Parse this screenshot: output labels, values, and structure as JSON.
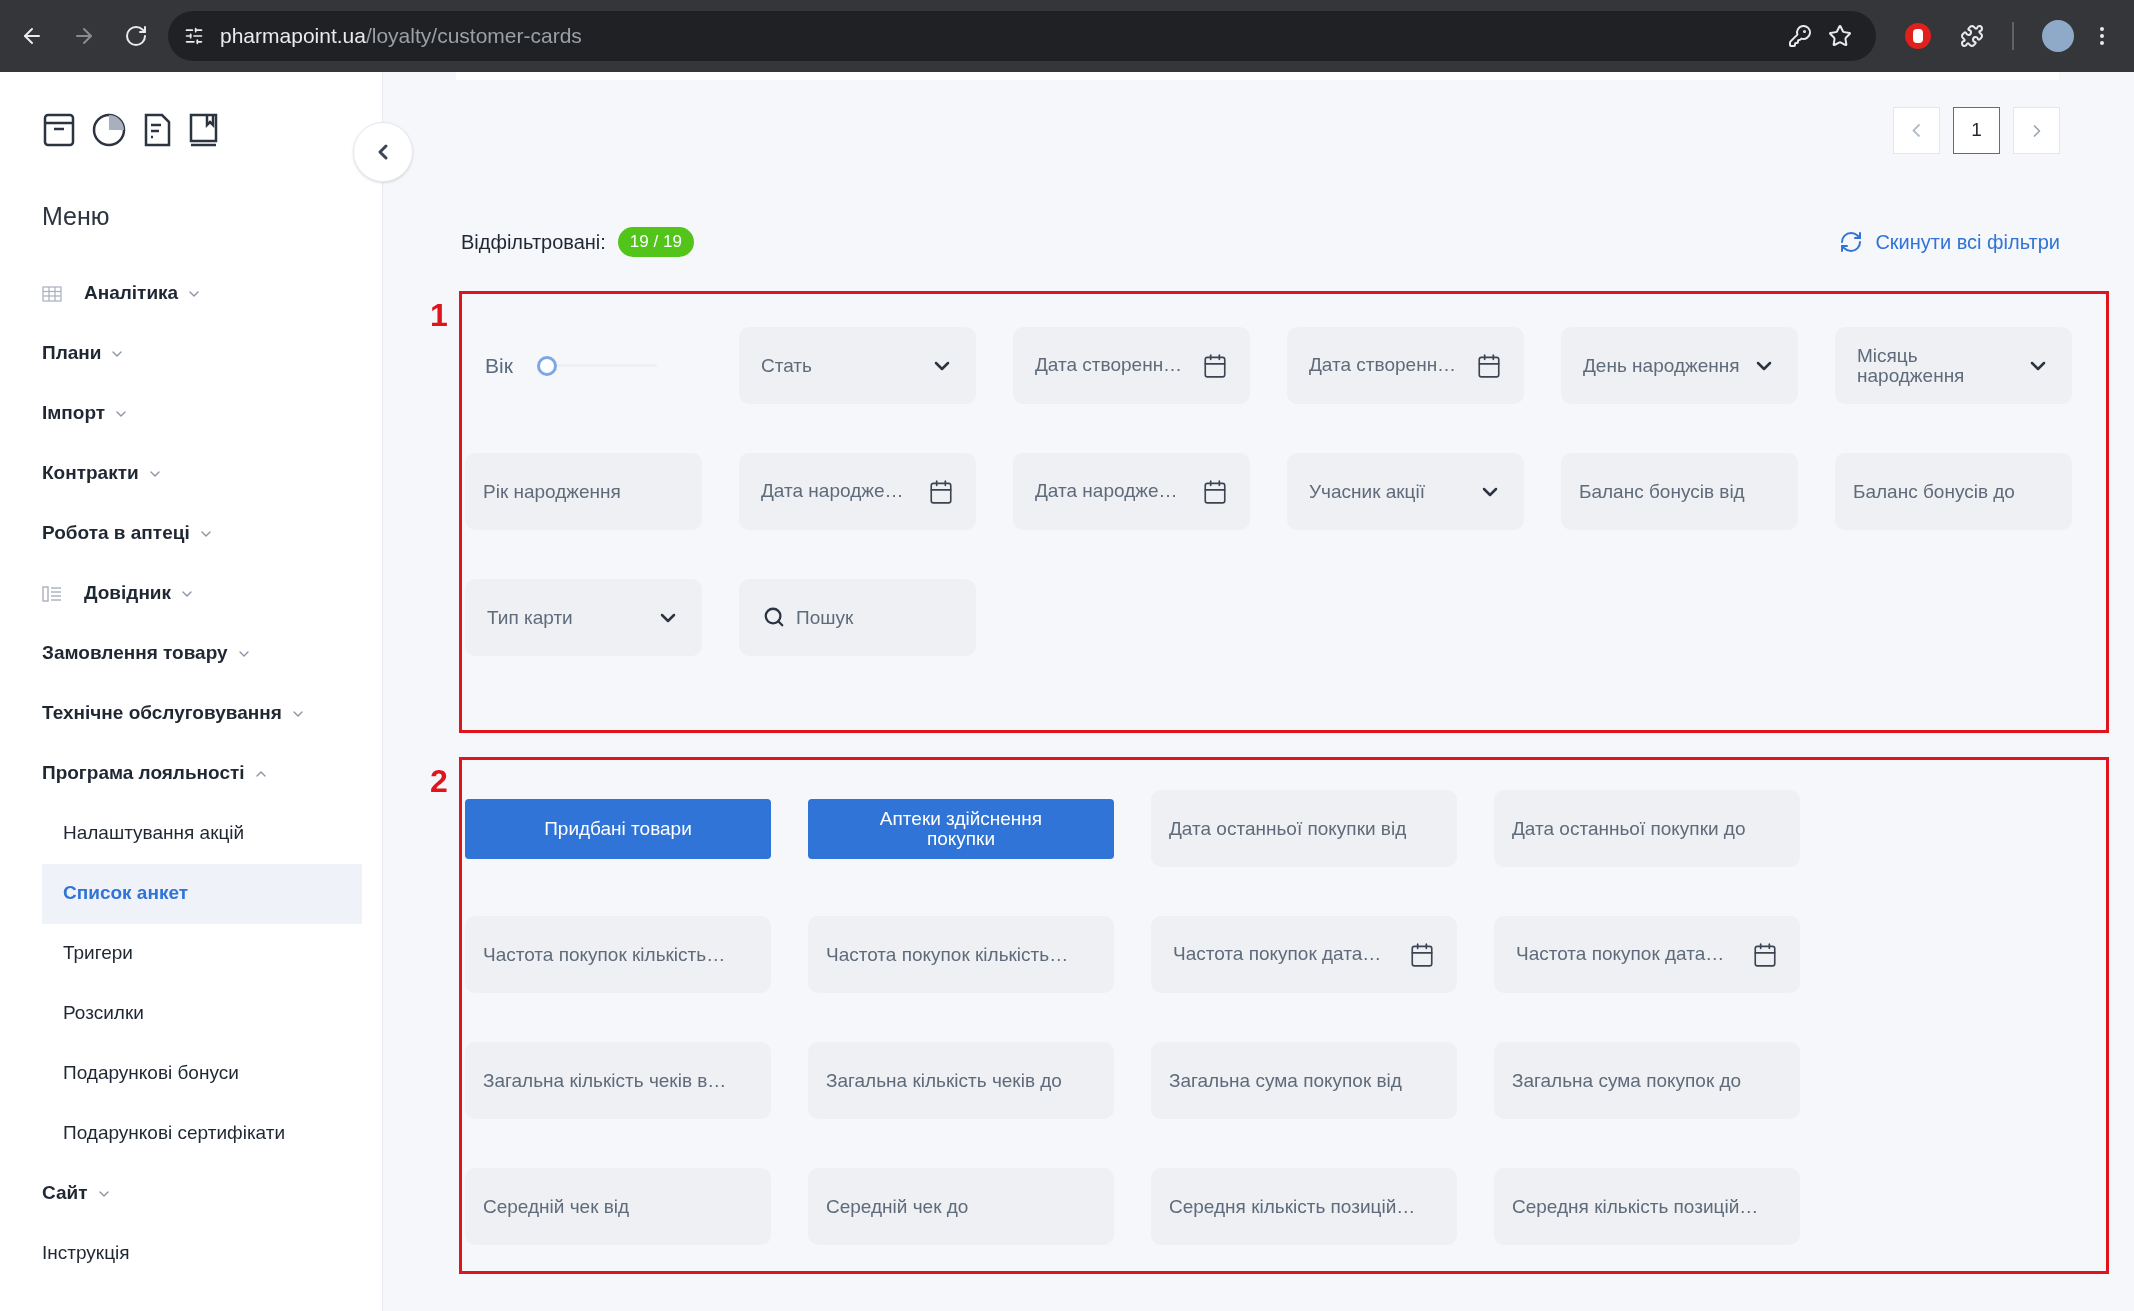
{
  "browser": {
    "url_host": "pharmapoint.ua",
    "url_path": "/loyalty/customer-cards"
  },
  "sidebar": {
    "title": "Меню",
    "items": [
      {
        "kind": "gridgroup",
        "label": "Аналітика",
        "expanded": false
      },
      {
        "kind": "group",
        "label": "Плани",
        "expanded": false
      },
      {
        "kind": "group",
        "label": "Імпорт",
        "expanded": false
      },
      {
        "kind": "group",
        "label": "Контракти",
        "expanded": false
      },
      {
        "kind": "group",
        "label": "Робота в аптеці",
        "expanded": false
      },
      {
        "kind": "listgroup",
        "label": "Довідник",
        "expanded": false
      },
      {
        "kind": "group",
        "label": "Замовлення товару",
        "expanded": false
      },
      {
        "kind": "group",
        "label": "Технічне обслуговування",
        "expanded": false
      },
      {
        "kind": "group",
        "label": "Програма лояльності",
        "expanded": true,
        "children": [
          {
            "label": "Налаштування акцій",
            "selected": false
          },
          {
            "label": "Список анкет",
            "selected": true
          },
          {
            "label": "Тригери",
            "selected": false
          },
          {
            "label": "Розсилки",
            "selected": false
          },
          {
            "label": "Подарункові бонуси",
            "selected": false
          },
          {
            "label": "Подарункові сертифікати",
            "selected": false
          }
        ]
      },
      {
        "kind": "group",
        "label": "Сайт",
        "expanded": false
      },
      {
        "kind": "link",
        "label": "Інструкція"
      }
    ]
  },
  "pagination": {
    "pages": [
      {
        "label": "1",
        "selected": true
      }
    ]
  },
  "filter_header": {
    "label": "Відфільтровані:",
    "count": "19 / 19",
    "reset": "Скинути всі фільтри"
  },
  "sections": [
    {
      "marker": "1",
      "fields": [
        {
          "kind": "slider",
          "label": "Вік",
          "level": 0
        },
        {
          "kind": "select",
          "label": "Стать"
        },
        {
          "kind": "date",
          "label": "Дата створенн…"
        },
        {
          "kind": "date",
          "label": "Дата створенн…"
        },
        {
          "kind": "select",
          "label": "День народження"
        },
        {
          "kind": "select",
          "label": "Місяць народження"
        },
        {
          "kind": "text",
          "placeholder": "Рік народження"
        },
        {
          "kind": "date",
          "label": "Дата народже…"
        },
        {
          "kind": "date",
          "label": "Дата народже…"
        },
        {
          "kind": "select",
          "label": "Учасник акції"
        },
        {
          "kind": "text",
          "placeholder": "Баланс бонусів від"
        },
        {
          "kind": "text",
          "placeholder": "Баланс бонусів до"
        },
        {
          "kind": "select",
          "label": "Тип карти"
        },
        {
          "kind": "search",
          "placeholder": "Пошук"
        }
      ]
    },
    {
      "marker": "2",
      "fields": [
        {
          "kind": "button",
          "label": "Придбані товари"
        },
        {
          "kind": "button",
          "label": "Аптеки здійснення покупки"
        },
        {
          "kind": "text",
          "placeholder": "Дата останньої покупки від"
        },
        {
          "kind": "text",
          "placeholder": "Дата останньої покупки до"
        },
        {
          "kind": "text",
          "placeholder": "Частота покупок кількість…"
        },
        {
          "kind": "text",
          "placeholder": "Частота покупок кількість…"
        },
        {
          "kind": "date",
          "label": "Частота покупок дата…"
        },
        {
          "kind": "date",
          "label": "Частота покупок дата…"
        },
        {
          "kind": "text",
          "placeholder": "Загальна кількість чеків в…"
        },
        {
          "kind": "text",
          "placeholder": "Загальна кількість чеків до"
        },
        {
          "kind": "text",
          "placeholder": "Загальна сума покупок від"
        },
        {
          "kind": "text",
          "placeholder": "Загальна сума покупок до"
        },
        {
          "kind": "text",
          "placeholder": "Середній чек від"
        },
        {
          "kind": "text",
          "placeholder": "Середній чек до"
        },
        {
          "kind": "text",
          "placeholder": "Середня кількість позицій…"
        },
        {
          "kind": "text",
          "placeholder": "Середня кількість позицій…"
        }
      ]
    }
  ]
}
